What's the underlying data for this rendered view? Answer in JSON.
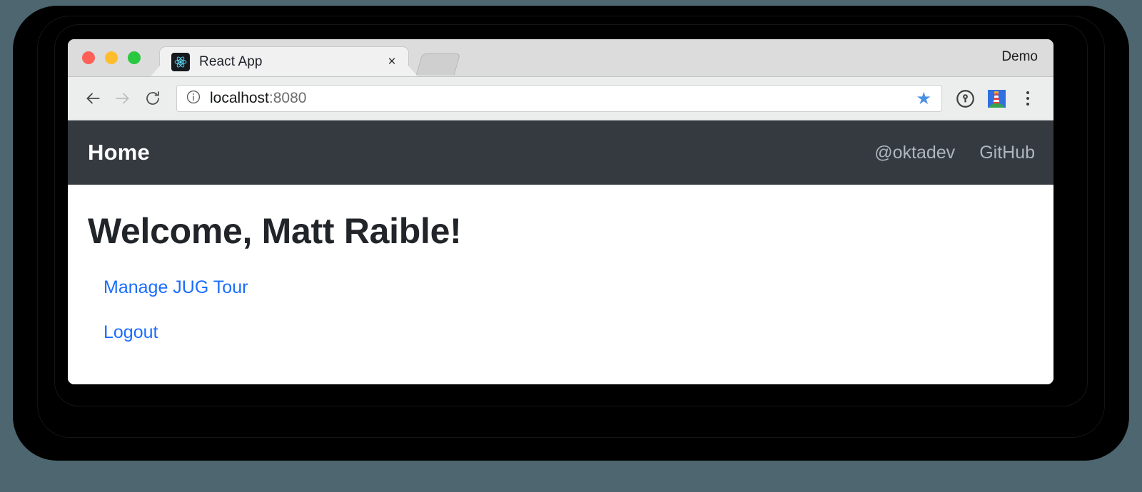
{
  "browser": {
    "window_controls": [
      {
        "name": "close",
        "color": "#ff5f57"
      },
      {
        "name": "minimize",
        "color": "#ffbd2e"
      },
      {
        "name": "maximize",
        "color": "#28c840"
      }
    ],
    "tab": {
      "title": "React App",
      "favicon": "react-logo-icon",
      "close_label": "×"
    },
    "new_tab_label": "",
    "profile_label": "Demo",
    "toolbar": {
      "back_icon": "arrow-left-icon",
      "forward_icon": "arrow-right-icon",
      "reload_icon": "reload-icon",
      "site_info_icon": "info-circle-icon",
      "url_host": "localhost",
      "url_port": ":8080",
      "url_full": "localhost:8080",
      "bookmark_icon": "star-icon",
      "extensions": [
        {
          "name": "onepassword-icon",
          "label": "1Password"
        },
        {
          "name": "lighthouse-icon",
          "label": "Lighthouse"
        }
      ],
      "menu_icon": "kebab-menu-icon"
    }
  },
  "app": {
    "navbar": {
      "brand": "Home",
      "links": [
        {
          "label": "@oktadev"
        },
        {
          "label": "GitHub"
        }
      ],
      "background": "#343a40",
      "link_color": "#adb5bd"
    },
    "content": {
      "heading": "Welcome, Matt Raible!",
      "links": [
        {
          "label": "Manage JUG Tour"
        },
        {
          "label": "Logout"
        }
      ],
      "link_color": "#1a6dff"
    }
  }
}
